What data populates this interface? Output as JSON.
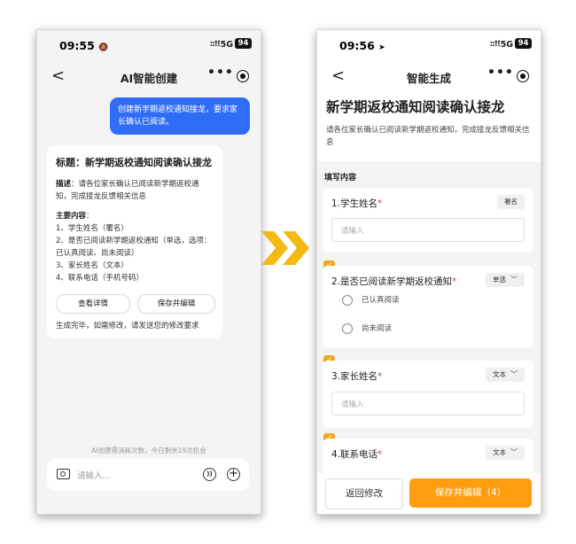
{
  "left": {
    "status": {
      "time": "09:55",
      "time_icon": "bell-slash-icon",
      "signal": "::!!",
      "network": "5G",
      "battery": "94"
    },
    "nav": {
      "back": "<",
      "title": "AI智能创建",
      "more": "•••"
    },
    "user_message": "创建新学期返校通知接龙，要求家长确认已阅读。",
    "card": {
      "title": "标题：新学期返校通知阅读确认接龙",
      "desc_label": "描述",
      "desc_text": "：请各位家长确认已阅读新学期返校通知，完成接龙反馈相关信息",
      "section_label": "主要内容",
      "section_colon": "：",
      "items": [
        "1、学生姓名（署名）",
        "2、是否已阅读新学期返校通知（单选，选项：已认真阅读、尚未阅读）",
        "3、家长姓名（文本）",
        "4、联系电话（手机号码）"
      ],
      "view_button": "查看详情",
      "save_edit_button": "保存并编辑",
      "note": "生成完毕，如需修改，请发送您的修改要求"
    },
    "quota": "AI创建需消耗次数，今日剩余19次机会",
    "input_placeholder": "请输入..."
  },
  "right": {
    "status": {
      "time": "09:56",
      "time_icon": "location-arrow-icon",
      "signal": "::!!",
      "network": "5G",
      "battery": "94"
    },
    "nav": {
      "back": "<",
      "title": "智能生成",
      "more": "•••"
    },
    "form_title": "新学期返校通知阅读确认接龙",
    "form_desc": "请各位家长确认已阅读新学期返校通知，完成接龙反馈相关信息",
    "section_label": "填写内容",
    "questions": [
      {
        "title": "1.学生姓名",
        "required": "*",
        "tag": "署名",
        "placeholder": "请输入"
      },
      {
        "title": "2.是否已阅读新学期返校通知",
        "required": "*",
        "tag": "单选",
        "options": [
          "已认真阅读",
          "尚未阅读"
        ]
      },
      {
        "title": "3.家长姓名",
        "required": "*",
        "tag": "文本",
        "placeholder": "请输入"
      },
      {
        "title": "4.联系电话",
        "required": "*",
        "tag": "文本"
      }
    ],
    "back_button": "返回修改",
    "save_button": "保存并编辑（4）"
  },
  "accent_colors": {
    "chat_blue": "#2f6df6",
    "primary_orange": "#ff9d10",
    "arrow_yellow": "#f5b814"
  }
}
